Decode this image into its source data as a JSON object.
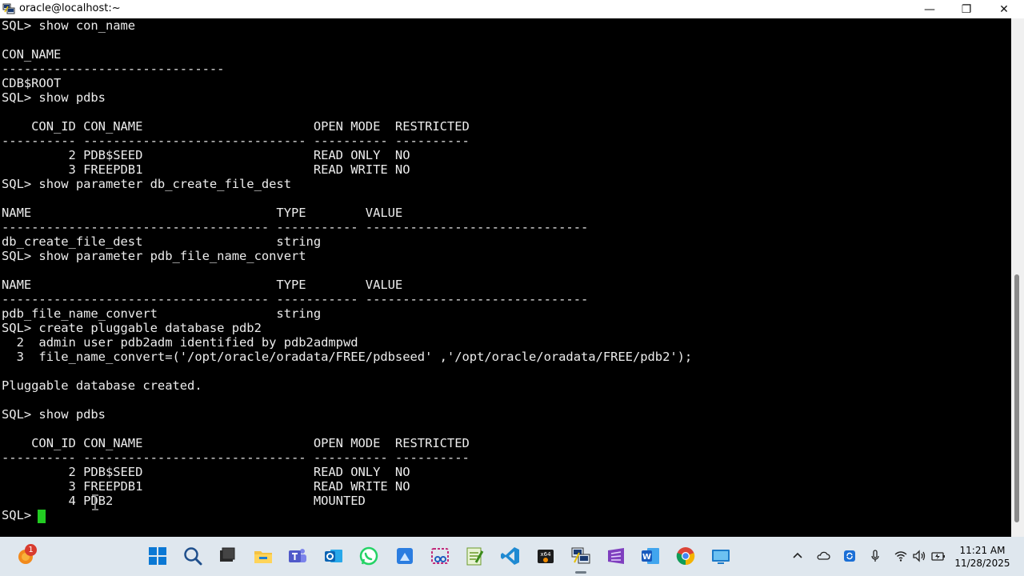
{
  "window": {
    "title": "oracle@localhost:~",
    "minimize_glyph": "—",
    "maximize_glyph": "❐",
    "close_glyph": "✕"
  },
  "terminal": {
    "lines": [
      "SQL> show con_name",
      "",
      "CON_NAME",
      "------------------------------",
      "CDB$ROOT",
      "SQL> show pdbs",
      "",
      "    CON_ID CON_NAME                       OPEN MODE  RESTRICTED",
      "---------- ------------------------------ ---------- ----------",
      "         2 PDB$SEED                       READ ONLY  NO",
      "         3 FREEPDB1                       READ WRITE NO",
      "SQL> show parameter db_create_file_dest",
      "",
      "NAME                                 TYPE        VALUE",
      "------------------------------------ ----------- ------------------------------",
      "db_create_file_dest                  string",
      "SQL> show parameter pdb_file_name_convert",
      "",
      "NAME                                 TYPE        VALUE",
      "------------------------------------ ----------- ------------------------------",
      "pdb_file_name_convert                string",
      "SQL> create pluggable database pdb2",
      "  2  admin user pdb2adm identified by pdb2admpwd",
      "  3  file_name_convert=('/opt/oracle/oradata/FREE/pdbseed' ,'/opt/oracle/oradata/FREE/pdb2');",
      "",
      "Pluggable database created.",
      "",
      "SQL> show pdbs",
      "",
      "    CON_ID CON_NAME                       OPEN MODE  RESTRICTED",
      "---------- ------------------------------ ---------- ----------",
      "         2 PDB$SEED                       READ ONLY  NO",
      "         3 FREEPDB1                       READ WRITE NO",
      "         4 PDB2                           MOUNTED",
      "SQL> "
    ],
    "cursor_color": "#22cc22"
  },
  "taskbar": {
    "notification_badge": "1",
    "time": "11:21 AM",
    "date": "11/28/2025",
    "icons": [
      "windows-start-icon",
      "search-icon",
      "terminal-app-icon",
      "file-explorer-icon",
      "teams-icon",
      "outlook-icon",
      "whatsapp-icon",
      "paint-icon",
      "snipping-tool-icon",
      "notepad-icon",
      "vscode-icon",
      "virtualbox-icon",
      "putty-icon",
      "visual-studio-icon",
      "word-icon",
      "chrome-icon",
      "remote-desktop-icon"
    ]
  },
  "colors": {
    "taskbar_bg": "#dfe7ee",
    "terminal_bg": "#000000",
    "terminal_fg": "#ececec"
  }
}
